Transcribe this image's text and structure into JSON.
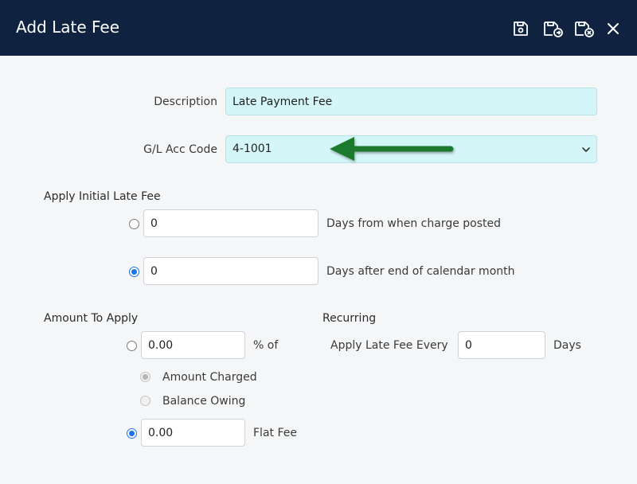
{
  "header": {
    "title": "Add Late Fee",
    "icons": [
      "save-icon",
      "save-and-new-icon",
      "save-and-close-icon",
      "close-icon"
    ],
    "background_color": "#0f2340"
  },
  "form": {
    "description": {
      "label": "Description",
      "value": "Late Payment Fee"
    },
    "gl_acc_code": {
      "label": "G/L Acc Code",
      "value": "4-1001"
    },
    "initial_late_fee": {
      "section_title": "Apply Initial Late Fee",
      "options": [
        {
          "value": "0",
          "label": "Days from when charge posted",
          "selected": false
        },
        {
          "value": "0",
          "label": "Days after end of calendar month",
          "selected": true
        }
      ]
    },
    "amount_to_apply": {
      "section_title": "Amount To Apply",
      "percent": {
        "value": "0.00",
        "suffix": "% of",
        "selected": false
      },
      "percent_basis": [
        {
          "label": "Amount Charged",
          "selected": true,
          "disabled": true
        },
        {
          "label": "Balance Owing",
          "selected": false,
          "disabled": true
        }
      ],
      "flat": {
        "value": "0.00",
        "suffix": "Flat Fee",
        "selected": true
      }
    },
    "recurring": {
      "section_title": "Recurring",
      "label": "Apply Late Fee Every",
      "value": "0",
      "unit": "Days"
    }
  },
  "colors": {
    "field_highlight": "#d4f6f9",
    "accent": "#1a73e8",
    "arrow": "#1f7a2e"
  }
}
